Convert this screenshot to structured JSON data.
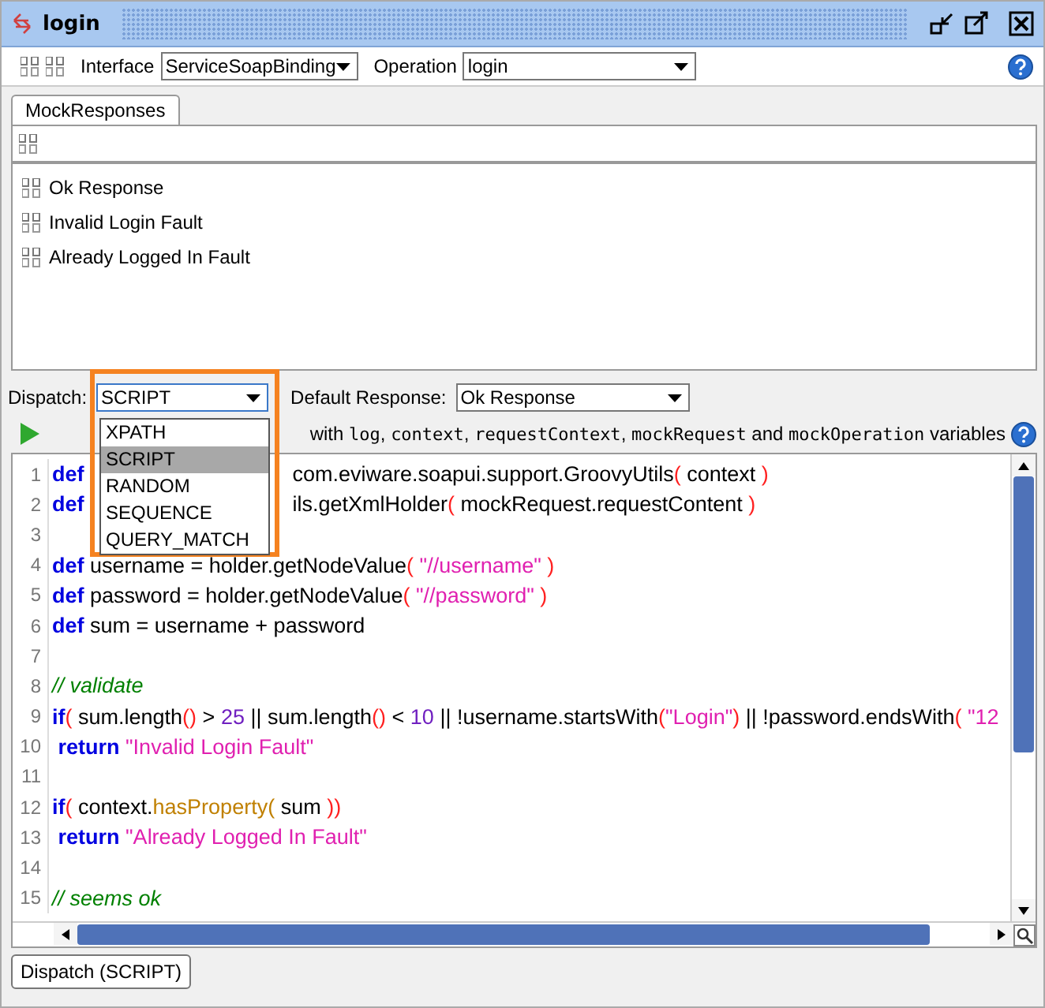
{
  "window": {
    "title": "login"
  },
  "toolbar": {
    "interface_label": "Interface",
    "interface": "ServiceSoapBinding",
    "operation_label": "Operation",
    "operation": "login"
  },
  "tabs": [
    {
      "label": "MockResponses",
      "selected": true
    }
  ],
  "responses": [
    {
      "name": "Ok Response"
    },
    {
      "name": "Invalid Login Fault"
    },
    {
      "name": "Already Logged In Fault"
    }
  ],
  "dispatch": {
    "label": "Dispatch:",
    "value": "SCRIPT",
    "expanded": true,
    "options": [
      {
        "label": "XPATH",
        "selected": false
      },
      {
        "label": "SCRIPT",
        "selected": true
      },
      {
        "label": "RANDOM",
        "selected": false
      },
      {
        "label": "SEQUENCE",
        "selected": false
      },
      {
        "label": "QUERY_MATCH",
        "selected": false
      }
    ],
    "default_label": "Default Response:",
    "default_value": "Ok Response"
  },
  "help_text": [
    {
      "kind": "text",
      "text": "with "
    },
    {
      "kind": "mono",
      "text": "log"
    },
    {
      "kind": "text",
      "text": ", "
    },
    {
      "kind": "mono",
      "text": "context"
    },
    {
      "kind": "text",
      "text": ", "
    },
    {
      "kind": "mono",
      "text": "requestContext"
    },
    {
      "kind": "text",
      "text": ", "
    },
    {
      "kind": "mono",
      "text": "mockRequest"
    },
    {
      "kind": "text",
      "text": " and "
    },
    {
      "kind": "mono",
      "text": "mockOperation"
    },
    {
      "kind": "text",
      "text": " variables"
    }
  ],
  "code_lines": [
    {
      "number": "1",
      "tokens": [
        {
          "kind": "keyword",
          "text": "def"
        },
        {
          "kind": "gap"
        },
        {
          "kind": "plain",
          "text": "com.eviware.soapui.support.GroovyUtils"
        },
        {
          "kind": "paren",
          "text": "("
        },
        {
          "kind": "plain",
          "text": " context "
        },
        {
          "kind": "paren",
          "text": ")"
        }
      ]
    },
    {
      "number": "2",
      "tokens": [
        {
          "kind": "keyword",
          "text": "def"
        },
        {
          "kind": "gap"
        },
        {
          "kind": "plain",
          "text": "ils.getXmlHolder"
        },
        {
          "kind": "paren",
          "text": "("
        },
        {
          "kind": "plain",
          "text": " mockRequest.requestContent "
        },
        {
          "kind": "paren",
          "text": ")"
        }
      ]
    },
    {
      "number": "3"
    },
    {
      "number": "4",
      "tokens": [
        {
          "kind": "keyword",
          "text": "def"
        },
        {
          "kind": "plain",
          "text": " username = holder.getNodeValue"
        },
        {
          "kind": "paren",
          "text": "( "
        },
        {
          "kind": "string",
          "text": "\"//username\""
        },
        {
          "kind": "paren",
          "text": " )"
        }
      ]
    },
    {
      "number": "5",
      "tokens": [
        {
          "kind": "keyword",
          "text": "def"
        },
        {
          "kind": "plain",
          "text": " password = holder.getNodeValue"
        },
        {
          "kind": "paren",
          "text": "( "
        },
        {
          "kind": "string",
          "text": "\"//password\""
        },
        {
          "kind": "paren",
          "text": " )"
        }
      ]
    },
    {
      "number": "6",
      "tokens": [
        {
          "kind": "keyword",
          "text": "def"
        },
        {
          "kind": "plain",
          "text": " sum = username + password"
        }
      ]
    },
    {
      "number": "7"
    },
    {
      "number": "8",
      "tokens": [
        {
          "kind": "comment",
          "text": "// validate"
        }
      ]
    },
    {
      "number": "9",
      "tokens": [
        {
          "kind": "keyword",
          "text": "if"
        },
        {
          "kind": "paren",
          "text": "("
        },
        {
          "kind": "plain",
          "text": " sum.length"
        },
        {
          "kind": "paren",
          "text": "()"
        },
        {
          "kind": "plain",
          "text": " > "
        },
        {
          "kind": "number",
          "text": "25"
        },
        {
          "kind": "plain",
          "text": " || sum.length"
        },
        {
          "kind": "paren",
          "text": "()"
        },
        {
          "kind": "plain",
          "text": " < "
        },
        {
          "kind": "number",
          "text": "10"
        },
        {
          "kind": "plain",
          "text": " || !username.startsWith"
        },
        {
          "kind": "paren",
          "text": "("
        },
        {
          "kind": "string",
          "text": "\"Login\""
        },
        {
          "kind": "paren",
          "text": ")"
        },
        {
          "kind": "plain",
          "text": " || !password.endsWith"
        },
        {
          "kind": "paren",
          "text": "( "
        },
        {
          "kind": "string",
          "text": "\"12"
        }
      ]
    },
    {
      "number": "10",
      "tokens": [
        {
          "kind": "keyword",
          "text": " return"
        },
        {
          "kind": "string",
          "text": " \"Invalid Login Fault\""
        }
      ]
    },
    {
      "number": "11"
    },
    {
      "number": "12",
      "tokens": [
        {
          "kind": "keyword",
          "text": "if"
        },
        {
          "kind": "paren",
          "text": "("
        },
        {
          "kind": "plain",
          "text": " context."
        },
        {
          "kind": "method",
          "text": "hasProperty( "
        },
        {
          "kind": "plain",
          "text": "sum "
        },
        {
          "kind": "paren",
          "text": "))"
        }
      ]
    },
    {
      "number": "13",
      "tokens": [
        {
          "kind": "keyword",
          "text": " return"
        },
        {
          "kind": "string",
          "text": " \"Already Logged In Fault\""
        }
      ]
    },
    {
      "number": "14"
    },
    {
      "number": "15",
      "tokens": [
        {
          "kind": "comment",
          "text": "// seems ok"
        }
      ]
    }
  ],
  "bottom_tabs": [
    {
      "label": "Dispatch (SCRIPT)",
      "selected": true
    }
  ]
}
